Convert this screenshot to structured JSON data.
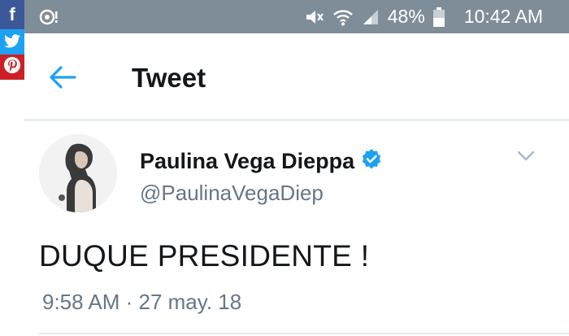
{
  "status_bar": {
    "battery": "48%",
    "time": "10:42 AM"
  },
  "share": {
    "facebook": "f",
    "pinterest": "p"
  },
  "header": {
    "title": "Tweet"
  },
  "tweet": {
    "author_name": "Paulina Vega Dieppa",
    "handle": "@PaulinaVegaDiep",
    "text": "DUQUE PRESIDENTE !",
    "timestamp": "9:58 AM · 27 may. 18"
  },
  "colors": {
    "accent": "#1da1f2",
    "status_bar_bg": "#7f8d98",
    "secondary_text": "#657786"
  }
}
